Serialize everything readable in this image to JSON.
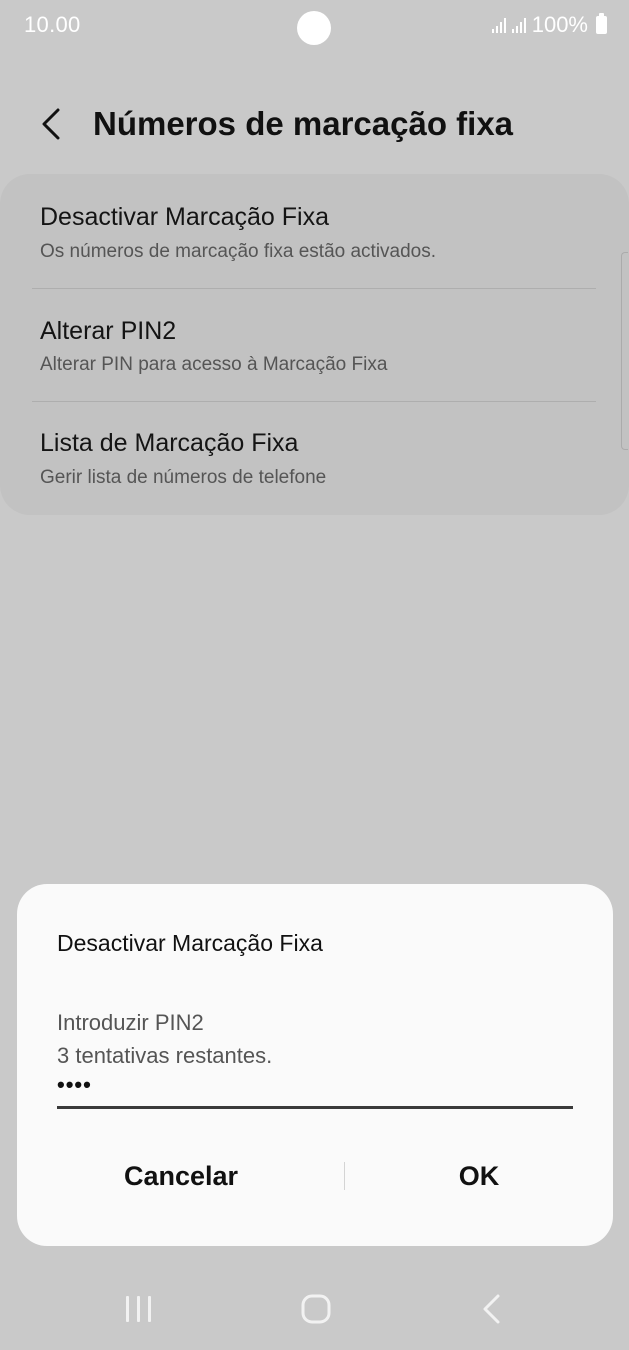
{
  "status_bar": {
    "time": "10.00",
    "battery": "100%"
  },
  "header": {
    "title": "Números de marcação fixa",
    "back_icon": "chevron-left-icon"
  },
  "settings": {
    "items": [
      {
        "title": "Desactivar Marcação Fixa",
        "subtitle": "Os números de marcação fixa estão activados."
      },
      {
        "title": "Alterar PIN2",
        "subtitle": "Alterar PIN para acesso à Marcação Fixa"
      },
      {
        "title": "Lista de Marcação Fixa",
        "subtitle": "Gerir lista de números de telefone"
      }
    ]
  },
  "dialog": {
    "title": "Desactivar Marcação Fixa",
    "message_line1": "Introduzir PIN2",
    "message_line2": "3 tentativas restantes.",
    "pin_value": "••••",
    "cancel_label": "Cancelar",
    "ok_label": "OK"
  },
  "nav_bar": {
    "recent_icon": "recent-apps-icon",
    "home_icon": "home-icon",
    "back_icon": "back-icon"
  },
  "colors": {
    "dim_background": "#c9c9c9",
    "card_background": "#c2c2c2",
    "dialog_background": "#fafafa",
    "primary_text": "#111111",
    "secondary_text": "#555555"
  }
}
